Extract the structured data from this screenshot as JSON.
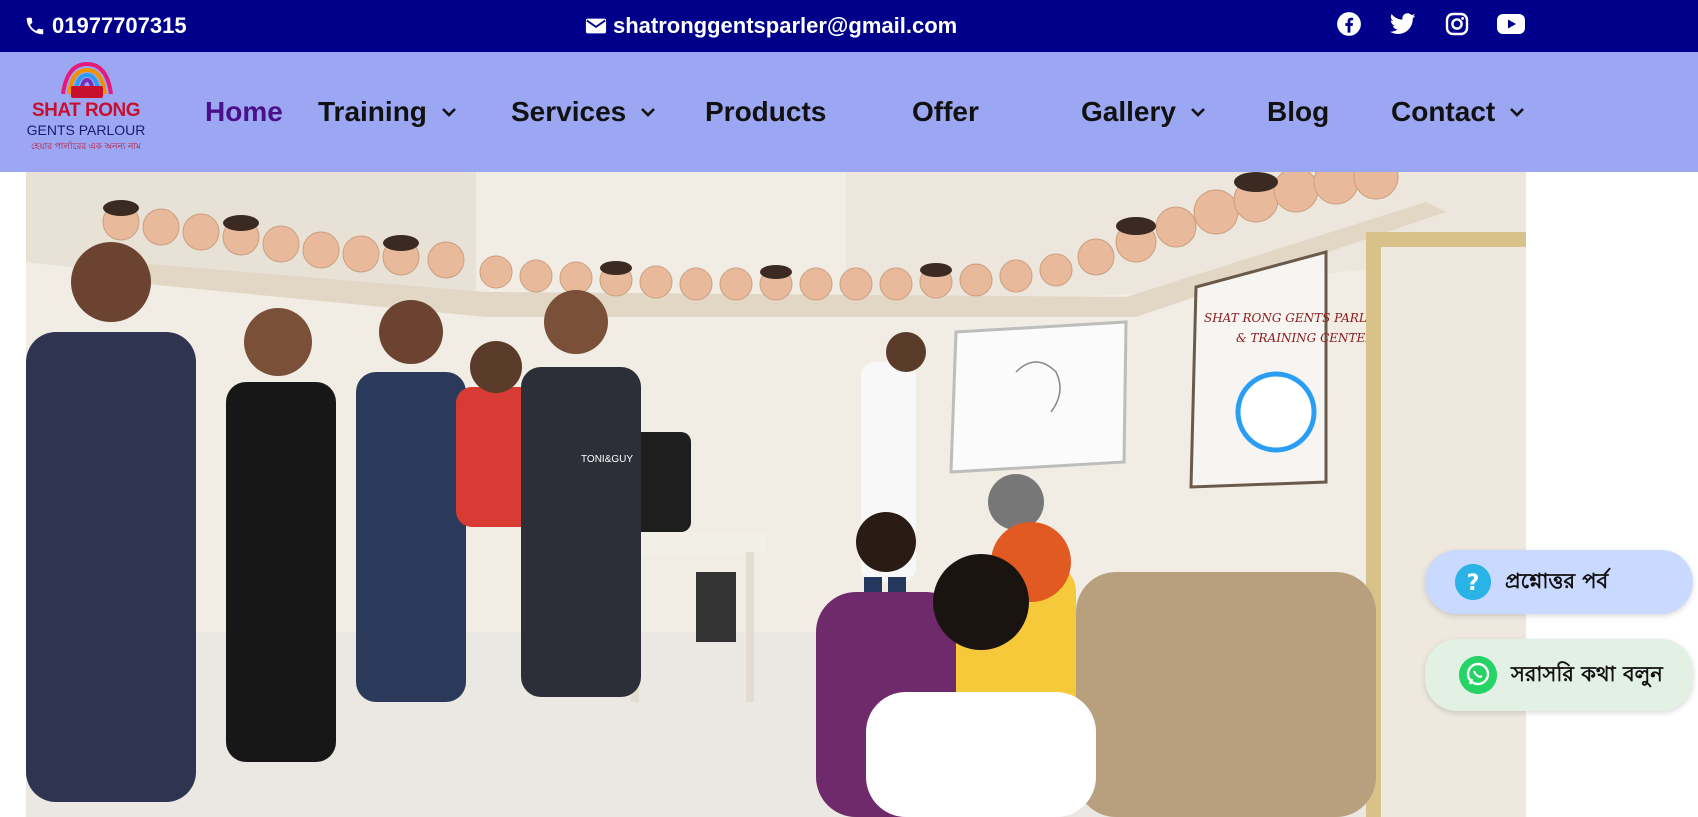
{
  "topbar": {
    "phone": "01977707315",
    "email": "shatronggentsparler@gmail.com",
    "social": [
      "facebook-icon",
      "twitter-icon",
      "instagram-icon",
      "youtube-icon"
    ],
    "bg_color": "#00008b"
  },
  "brand": {
    "line1": "SHAT RONG",
    "line2": "GENTS PARLOUR",
    "tagline": "হেয়ার পার্লারের এক অনন্য নাম"
  },
  "nav": {
    "bg_color": "#9ba7f2",
    "items": [
      {
        "label": "Home",
        "active": true,
        "dropdown": false
      },
      {
        "label": "Training",
        "active": false,
        "dropdown": true
      },
      {
        "label": "Services",
        "active": false,
        "dropdown": true
      },
      {
        "label": "Products",
        "active": false,
        "dropdown": false
      },
      {
        "label": "Offer",
        "active": false,
        "dropdown": false
      },
      {
        "label": "Gallery",
        "active": false,
        "dropdown": true
      },
      {
        "label": "Blog",
        "active": false,
        "dropdown": false
      },
      {
        "label": "Contact",
        "active": false,
        "dropdown": true
      }
    ]
  },
  "hero": {
    "poster_line1": "SHAT RONG GENTS PARLOUR",
    "poster_line2": "& TRAINING CENTER",
    "apron_text": "TONI&GUY"
  },
  "floating": {
    "qa_label": "প্রশ্নোত্তর পর্ব",
    "whatsapp_label": "সরাসরি কথা বলুন"
  }
}
